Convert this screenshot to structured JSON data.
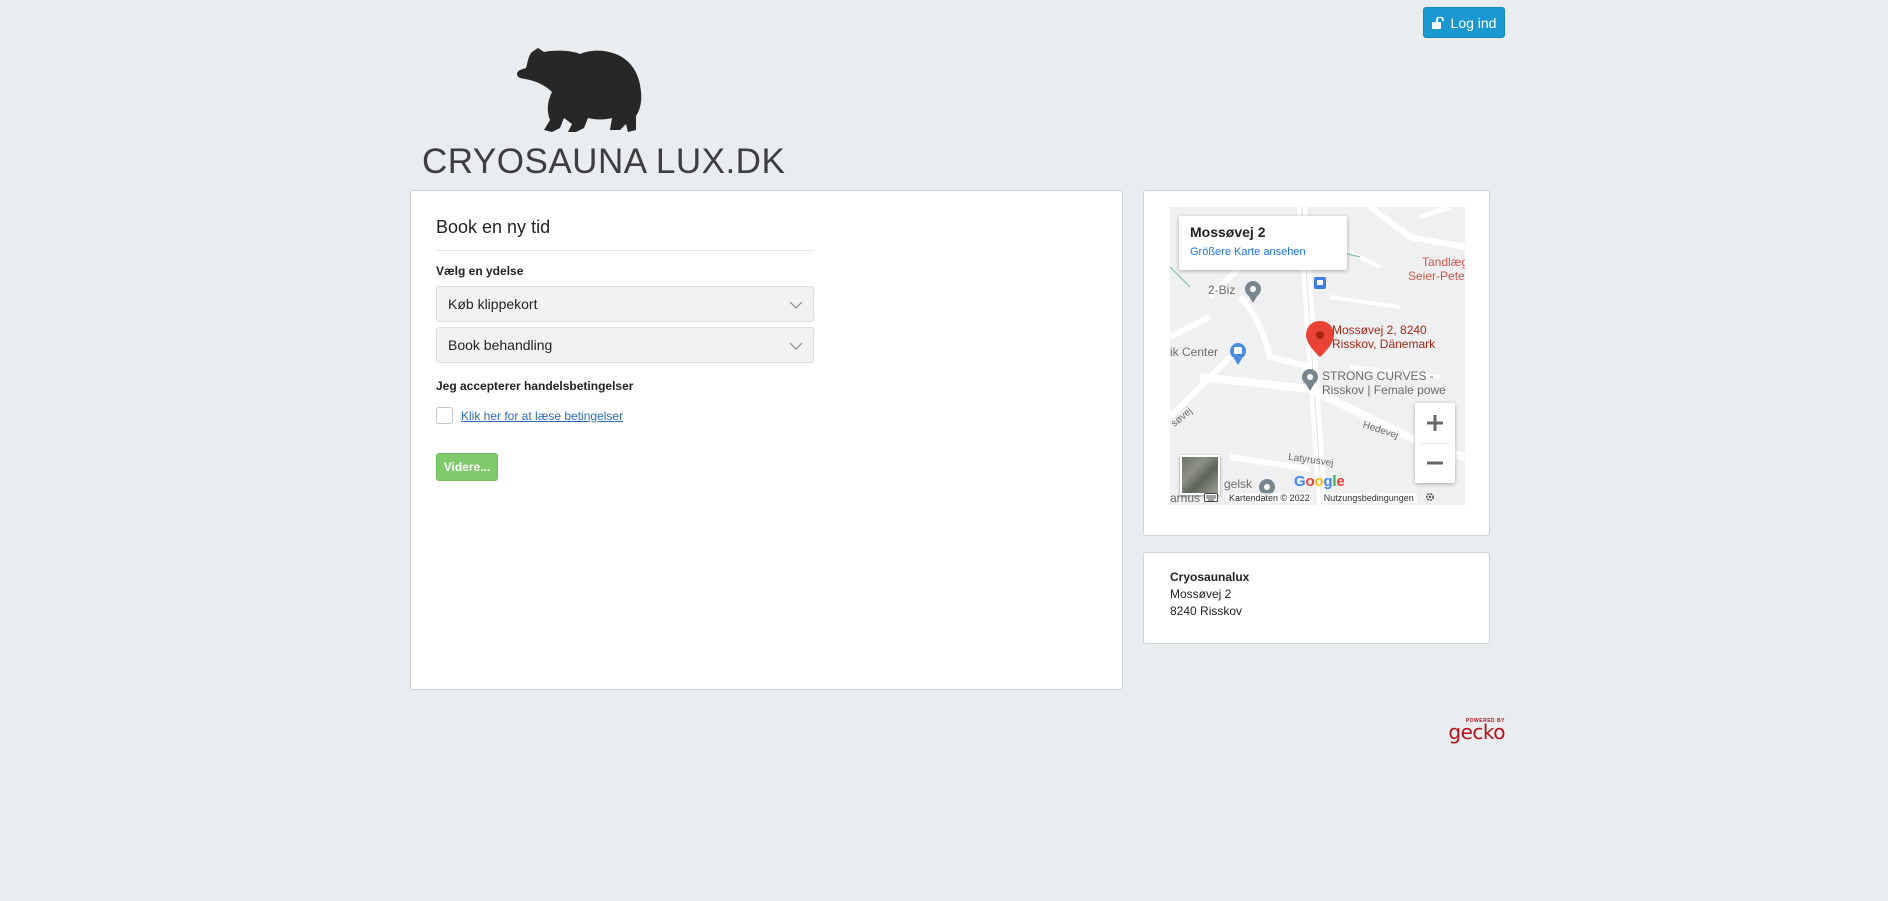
{
  "header": {
    "login_label": "Log ind",
    "logo_text": "CRYOSAUNA LUX.DK",
    "logo_icon": "bear-logo-icon"
  },
  "booking": {
    "title": "Book en ny tid",
    "service_label": "Vælg en ydelse",
    "selects": [
      {
        "value": "Køb klippekort"
      },
      {
        "value": "Book behandling"
      }
    ],
    "terms_label": "Jeg accepterer handelsbetingelser",
    "terms_link": "Klik her for at læse betingelser",
    "next_label": "Videre..."
  },
  "map": {
    "info_title": "Mossøvej 2",
    "info_link": "Größere Karte ansehen",
    "pin_label_line1": "Mossøvej 2, 8240",
    "pin_label_line2": "Risskov, Dänemark",
    "places": {
      "biz": "2-Biz",
      "center": "ik Center",
      "strong_line1": "STRONG CURVES -",
      "strong_line2": "Risskov | Female powe",
      "dentist_line1": "Tandlæge",
      "dentist_line2": "Seier-Peters"
    },
    "streets": {
      "hedevej": "Hedevej",
      "latyrusvej": "Latyrusvej",
      "sovej": "søvej",
      "gelsk": "gelsk",
      "arhus": "arhus"
    },
    "google": "Google",
    "attribution": "Kartendaten © 2022",
    "terms": "Nutzungsbedingungen",
    "colors": {
      "pin": "#ea4335",
      "pin_label": "#a52714",
      "poi_gray": "#78868e",
      "poi_blue": "#4a8de0",
      "dentist": "#d1554a"
    }
  },
  "address": {
    "company": "Cryosaunalux",
    "street": "Mossøvej 2",
    "city": "8240 Risskov"
  },
  "footer": {
    "powered_small": "POWERED BY",
    "powered_brand": "gecko",
    "brand_color": "#b0141a"
  },
  "colors": {
    "login_bg": "#1b98cf",
    "next_bg": "#7fca6b",
    "page_bg": "#e9edf0"
  }
}
